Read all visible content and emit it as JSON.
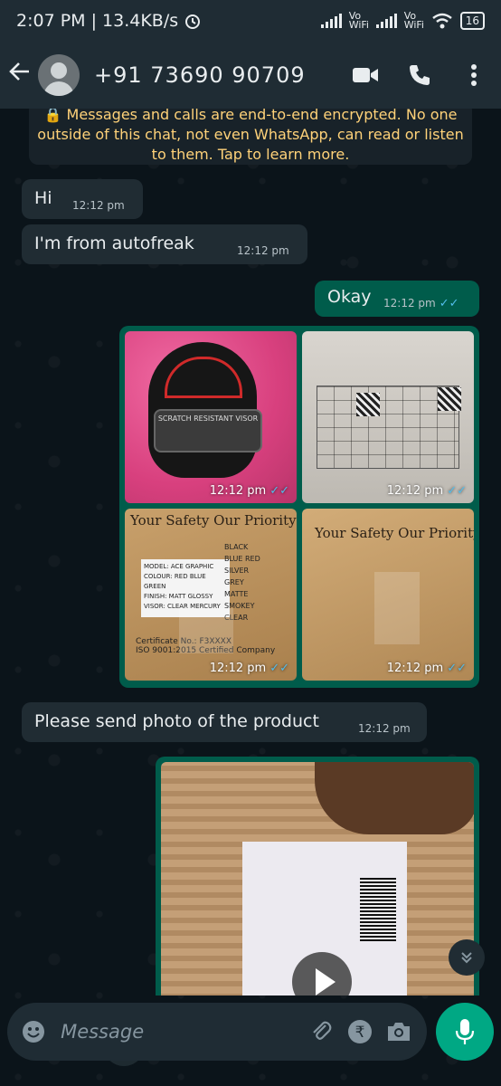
{
  "status_bar": {
    "time_speed": "2:07 PM | 13.4KB/s",
    "vowifi_1": "Vo WiFi",
    "vowifi_2": "Vo WiFi",
    "battery": "16"
  },
  "header": {
    "contact": "+91 73690 90709",
    "icons": [
      "back-arrow-icon",
      "avatar",
      "video-call-icon",
      "voice-call-icon",
      "more-options-icon"
    ]
  },
  "encryption_notice": "🔒 Messages and calls are end-to-end encrypted. No one outside of this chat, not even WhatsApp, can read or listen to them. Tap to learn more.",
  "messages": [
    {
      "direction": "in",
      "text": "Hi",
      "time": "12:12 pm"
    },
    {
      "direction": "in",
      "text": "I'm from autofreak",
      "time": "12:12 pm"
    },
    {
      "direction": "out",
      "text": "Okay",
      "time": "12:12 pm",
      "read": true
    },
    {
      "direction": "out",
      "type": "photo-group",
      "items": [
        {
          "time": "12:12 pm",
          "read": true
        },
        {
          "time": "12:12 pm",
          "read": true
        },
        {
          "time": "12:12 pm",
          "read": true
        },
        {
          "time": "12:12 pm",
          "read": true
        }
      ]
    },
    {
      "direction": "in",
      "text": "Please send photo of the product",
      "time": "12:12 pm"
    },
    {
      "direction": "out",
      "type": "video"
    }
  ],
  "photo_text": {
    "visor_print": "SCRATCH RESISTANT VISOR",
    "box_title_1": "Your Safety Our Priority",
    "box_title_2": "Your Safety Our Priority",
    "label_1": "MODEL: ACE GRAPHIC",
    "label_2": "COLOUR: RED BLUE GREEN",
    "label_3": "FINISH: MATT GLOSSY",
    "label_4": "VISOR: CLEAR MERCURY",
    "colors_list": "BLACK BLUE RED SILVER GREY MATTE SMOKEY CLEAR",
    "cert_1": "Certificate No.: F3XXXX",
    "cert_2": "ISO 9001:2015 Certified Company"
  },
  "composer": {
    "placeholder": "Message"
  },
  "colors": {
    "background": "#0b141a",
    "bar": "#1f2c34",
    "incoming": "#202c33",
    "outgoing": "#005c4b",
    "accent": "#00a884",
    "read_ticks": "#53bdeb",
    "system_text": "#ffd279"
  }
}
